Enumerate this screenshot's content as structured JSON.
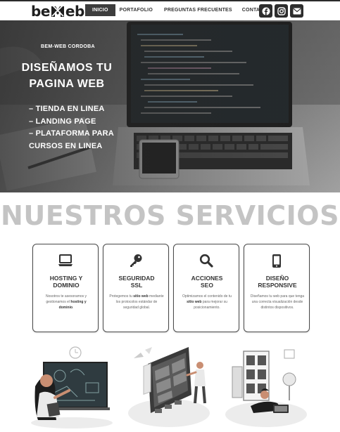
{
  "header": {
    "logo": {
      "text_left": "be",
      "text_right": "eb"
    },
    "nav": [
      {
        "label": "INICIO",
        "active": true
      },
      {
        "label": "PORTAFOLIO",
        "active": false
      },
      {
        "label": "PREGUNTAS FRECUENTES",
        "active": false
      },
      {
        "label": "CONTACTO",
        "active": false
      }
    ],
    "social": [
      "facebook-icon",
      "instagram-icon",
      "mail-icon"
    ]
  },
  "hero": {
    "kicker": "BEM-WEB CORDOBA",
    "title_line1": "DISEÑAMOS TU",
    "title_line2": "PAGINA WEB",
    "items": [
      "– TIENDA EN LINEA",
      "– LANDING PAGE",
      "– PLATAFORMA PARA",
      "CURSOS EN LINEA"
    ]
  },
  "services": {
    "title": "NUESTROS SERVICIOS",
    "cards": [
      {
        "icon": "laptop-icon",
        "title_line1": "HOSTING Y",
        "title_line2": "DOMINIO",
        "text_a": "Nosotros te asesoramos y gestionamos el ",
        "text_b": "hosting y dominio",
        "text_c": "."
      },
      {
        "icon": "key-icon",
        "title_line1": "SEGURIDAD",
        "title_line2": "SSL",
        "text_a": "Protegemos tu ",
        "text_b": "sitio web",
        "text_c": " mediante los protocolos estándar de seguridad global."
      },
      {
        "icon": "search-icon",
        "title_line1": "ACCIONES",
        "title_line2": "SEO",
        "text_a": "Optimizamos el contenido de tu ",
        "text_b": "sitio web",
        "text_c": " para mejorar su posicionamiento."
      },
      {
        "icon": "mobile-icon",
        "title_line1": "DISEÑO",
        "title_line2": "RESPONSIVE",
        "text_a": "Diseñamos tu web para que tenga una correcta visualización desde distintos dispositivos.",
        "text_b": "",
        "text_c": ""
      }
    ]
  },
  "colors": {
    "dark": "#2d2d2d",
    "services_title": "#c4c4c4",
    "nav_active_bg": "#3d3d3d"
  }
}
